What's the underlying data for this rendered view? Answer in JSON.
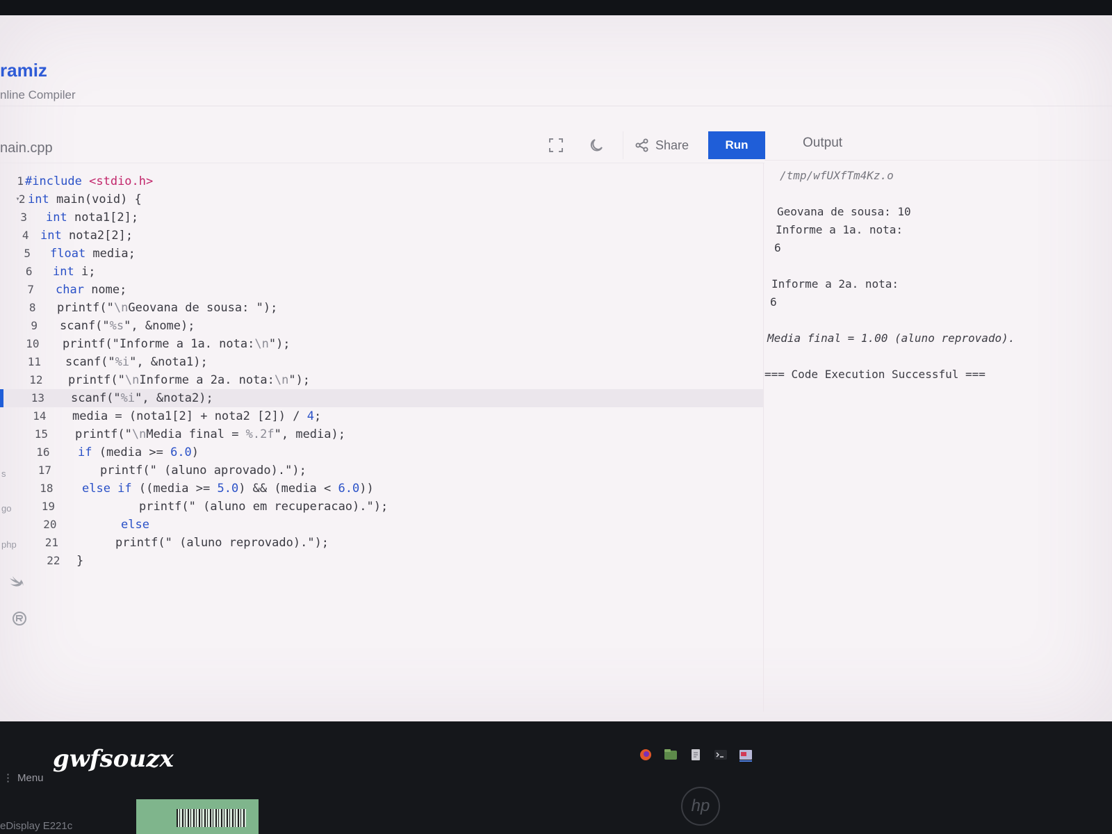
{
  "brand": {
    "name": "ramiz",
    "subtitle": "nline Compiler"
  },
  "editor": {
    "filename": "nain.cpp",
    "active_line": 13,
    "lines": [
      {
        "n": "1",
        "indent": 36,
        "segs": [
          {
            "t": "#include ",
            "c": "#2a51c7"
          },
          {
            "t": "<stdio.h>",
            "c": "#c2266b"
          }
        ]
      },
      {
        "n": "2",
        "fold": true,
        "indent": 40,
        "segs": [
          {
            "t": "int ",
            "c": "#2a51c7"
          },
          {
            "t": "main(void) {",
            "c": "#3a3a42"
          }
        ]
      },
      {
        "n": "3",
        "indent": 66,
        "segs": [
          {
            "t": "int ",
            "c": "#2a51c7"
          },
          {
            "t": "nota1[2];",
            "c": "#3a3a42"
          }
        ]
      },
      {
        "n": "4",
        "indent": 58,
        "segs": [
          {
            "t": "int ",
            "c": "#2a51c7"
          },
          {
            "t": "nota2[2];",
            "c": "#3a3a42"
          }
        ]
      },
      {
        "n": "5",
        "indent": 72,
        "segs": [
          {
            "t": "float ",
            "c": "#2a51c7"
          },
          {
            "t": "media;",
            "c": "#3a3a42"
          }
        ]
      },
      {
        "n": "6",
        "indent": 76,
        "segs": [
          {
            "t": "int ",
            "c": "#2a51c7"
          },
          {
            "t": "i;",
            "c": "#3a3a42"
          }
        ]
      },
      {
        "n": "7",
        "indent": 80,
        "segs": [
          {
            "t": "char ",
            "c": "#2a51c7"
          },
          {
            "t": "nome;",
            "c": "#3a3a42"
          }
        ]
      },
      {
        "n": "8",
        "indent": 82,
        "segs": [
          {
            "t": "printf(\"",
            "c": "#3a3a42"
          },
          {
            "t": "\\n",
            "c": "#8b8b95"
          },
          {
            "t": "Geovana de sousa: \");",
            "c": "#3a3a42"
          }
        ]
      },
      {
        "n": "9",
        "indent": 86,
        "segs": [
          {
            "t": "scanf(\"",
            "c": "#3a3a42"
          },
          {
            "t": "%s",
            "c": "#8b8b95"
          },
          {
            "t": "\", &nome);",
            "c": "#3a3a42"
          }
        ]
      },
      {
        "n": "10",
        "indent": 90,
        "segs": [
          {
            "t": "printf(\"Informe a 1a. nota:",
            "c": "#3a3a42"
          },
          {
            "t": "\\n",
            "c": "#8b8b95"
          },
          {
            "t": "\");",
            "c": "#3a3a42"
          }
        ]
      },
      {
        "n": "11",
        "indent": 94,
        "segs": [
          {
            "t": "scanf(\"",
            "c": "#3a3a42"
          },
          {
            "t": "%i",
            "c": "#8b8b95"
          },
          {
            "t": "\", &nota1);",
            "c": "#3a3a42"
          }
        ]
      },
      {
        "n": "12",
        "indent": 98,
        "segs": [
          {
            "t": "printf(\"",
            "c": "#3a3a42"
          },
          {
            "t": "\\n",
            "c": "#8b8b95"
          },
          {
            "t": "Informe a 2a. nota:",
            "c": "#3a3a42"
          },
          {
            "t": "\\n",
            "c": "#8b8b95"
          },
          {
            "t": "\");",
            "c": "#3a3a42"
          }
        ]
      },
      {
        "n": "13",
        "indent": 102,
        "segs": [
          {
            "t": "scanf(\"",
            "c": "#3a3a42"
          },
          {
            "t": "%i",
            "c": "#8b8b95"
          },
          {
            "t": "\", &nota2);",
            "c": "#3a3a42"
          }
        ]
      },
      {
        "n": "14",
        "indent": 104,
        "segs": [
          {
            "t": "media = (nota1[2] + nota2 [2]) / ",
            "c": "#3a3a42"
          },
          {
            "t": "4",
            "c": "#2a51c7"
          },
          {
            "t": ";",
            "c": "#3a3a42"
          }
        ]
      },
      {
        "n": "15",
        "indent": 108,
        "segs": [
          {
            "t": "printf(\"",
            "c": "#3a3a42"
          },
          {
            "t": "\\n",
            "c": "#8b8b95"
          },
          {
            "t": "Media final = ",
            "c": "#3a3a42"
          },
          {
            "t": "%.2f",
            "c": "#8b8b95"
          },
          {
            "t": "\", media);",
            "c": "#3a3a42"
          }
        ]
      },
      {
        "n": "16",
        "indent": 112,
        "segs": [
          {
            "t": "if ",
            "c": "#2a51c7"
          },
          {
            "t": "(media >= ",
            "c": "#3a3a42"
          },
          {
            "t": "6.0",
            "c": "#2a51c7"
          },
          {
            "t": ")",
            "c": "#3a3a42"
          }
        ]
      },
      {
        "n": "17",
        "indent": 144,
        "segs": [
          {
            "t": "printf(\" (aluno aprovado).\");",
            "c": "#3a3a42"
          }
        ]
      },
      {
        "n": "18",
        "indent": 118,
        "segs": [
          {
            "t": "else if ",
            "c": "#2a51c7"
          },
          {
            "t": "((media >= ",
            "c": "#3a3a42"
          },
          {
            "t": "5.0",
            "c": "#2a51c7"
          },
          {
            "t": ") && (media < ",
            "c": "#3a3a42"
          },
          {
            "t": "6.0",
            "c": "#2a51c7"
          },
          {
            "t": "))",
            "c": "#3a3a42"
          }
        ]
      },
      {
        "n": "19",
        "indent": 200,
        "segs": [
          {
            "t": "printf(\" (aluno em recuperacao).\");",
            "c": "#3a3a42"
          }
        ]
      },
      {
        "n": "20",
        "indent": 174,
        "segs": [
          {
            "t": "else",
            "c": "#2a51c7"
          }
        ]
      },
      {
        "n": "21",
        "indent": 166,
        "segs": [
          {
            "t": "printf(\" (aluno reprovado).\");",
            "c": "#3a3a42"
          }
        ]
      },
      {
        "n": "22",
        "indent": 110,
        "segs": [
          {
            "t": "}",
            "c": "#3a3a42"
          }
        ]
      }
    ]
  },
  "toolbar": {
    "share_label": "Share",
    "run_label": "Run",
    "fullscreen_icon": "fullscreen-icon",
    "theme_icon": "moon-icon",
    "share_icon": "share-icon"
  },
  "output": {
    "tab_label": "Output",
    "lines": [
      {
        "text": "/tmp/wfUXfTm4Kz.o",
        "kind": "path"
      },
      {
        "text": "",
        "kind": "blank"
      },
      {
        "text": "Geovana de sousa: 10",
        "kind": "text"
      },
      {
        "text": "Informe a 1a. nota:",
        "kind": "text"
      },
      {
        "text": "6",
        "kind": "text"
      },
      {
        "text": "",
        "kind": "blank"
      },
      {
        "text": "Informe a 2a. nota:",
        "kind": "text"
      },
      {
        "text": "6",
        "kind": "text"
      },
      {
        "text": "",
        "kind": "blank"
      },
      {
        "text": "Media final = 1.00 (aluno reprovado).",
        "kind": "msg"
      },
      {
        "text": "",
        "kind": "blank"
      },
      {
        "text": "=== Code Execution Successful ===",
        "kind": "text"
      }
    ]
  },
  "sidebar": {
    "labels": [
      "s",
      "go",
      "php"
    ]
  },
  "taskbar": {
    "menu_label": "Menu"
  },
  "overlay": {
    "watermark": "gwfsouzx"
  },
  "monitor": {
    "brand": "hp",
    "model": "eDisplay E221c"
  },
  "colors": {
    "accent": "#1f5ed8",
    "keyword": "#2a51c7",
    "include": "#c2266b"
  }
}
